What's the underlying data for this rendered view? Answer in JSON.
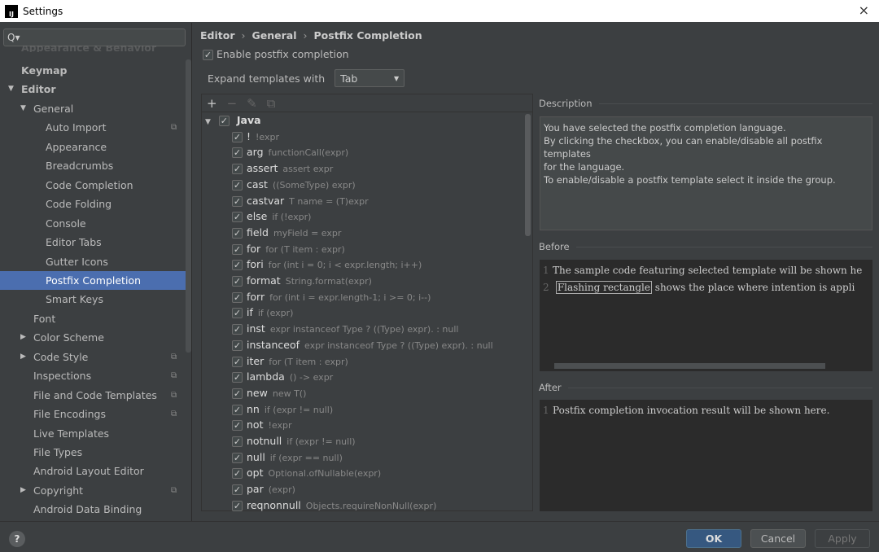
{
  "window": {
    "title": "Settings",
    "app_icon": "intellij-icon",
    "close": "×"
  },
  "sidebar": {
    "search_placeholder": "",
    "search_icon": "Q▾",
    "faded_item": "Appearance & Behavior",
    "items": [
      {
        "label": "Keymap",
        "level": 0,
        "bold": true
      },
      {
        "label": "Editor",
        "level": 0,
        "bold": true,
        "expanded": true
      },
      {
        "label": "General",
        "level": 1,
        "expanded": true
      },
      {
        "label": "Auto Import",
        "level": 2,
        "copy": true
      },
      {
        "label": "Appearance",
        "level": 2
      },
      {
        "label": "Breadcrumbs",
        "level": 2
      },
      {
        "label": "Code Completion",
        "level": 2
      },
      {
        "label": "Code Folding",
        "level": 2
      },
      {
        "label": "Console",
        "level": 2
      },
      {
        "label": "Editor Tabs",
        "level": 2
      },
      {
        "label": "Gutter Icons",
        "level": 2
      },
      {
        "label": "Postfix Completion",
        "level": 2,
        "selected": true
      },
      {
        "label": "Smart Keys",
        "level": 2
      },
      {
        "label": "Font",
        "level": 1
      },
      {
        "label": "Color Scheme",
        "level": 1,
        "collapsed": true
      },
      {
        "label": "Code Style",
        "level": 1,
        "collapsed": true,
        "copy": true
      },
      {
        "label": "Inspections",
        "level": 1,
        "copy": true
      },
      {
        "label": "File and Code Templates",
        "level": 1,
        "copy": true
      },
      {
        "label": "File Encodings",
        "level": 1,
        "copy": true
      },
      {
        "label": "Live Templates",
        "level": 1
      },
      {
        "label": "File Types",
        "level": 1
      },
      {
        "label": "Android Layout Editor",
        "level": 1
      },
      {
        "label": "Copyright",
        "level": 1,
        "collapsed": true,
        "copy": true
      },
      {
        "label": "Android Data Binding",
        "level": 1
      }
    ]
  },
  "breadcrumb": [
    "Editor",
    "General",
    "Postfix Completion"
  ],
  "breadcrumb_sep": "›",
  "enable_postfix": {
    "label": "Enable postfix completion",
    "checked": true
  },
  "expand": {
    "label": "Expand templates with",
    "value": "Tab"
  },
  "toolbar": {
    "add": "+",
    "remove": "−",
    "edit": "✎",
    "copy": "⧉"
  },
  "templates": {
    "group": "Java",
    "items": [
      {
        "key": "!",
        "desc": "!expr"
      },
      {
        "key": "arg",
        "desc": "functionCall(expr)"
      },
      {
        "key": "assert",
        "desc": "assert expr"
      },
      {
        "key": "cast",
        "desc": "((SomeType) expr)"
      },
      {
        "key": "castvar",
        "desc": "T name = (T)expr"
      },
      {
        "key": "else",
        "desc": "if (!expr)"
      },
      {
        "key": "field",
        "desc": "myField = expr"
      },
      {
        "key": "for",
        "desc": "for (T item : expr)"
      },
      {
        "key": "fori",
        "desc": "for (int i = 0; i < expr.length; i++)"
      },
      {
        "key": "format",
        "desc": "String.format(expr)"
      },
      {
        "key": "forr",
        "desc": "for (int i = expr.length-1; i >= 0; i--)"
      },
      {
        "key": "if",
        "desc": "if (expr)"
      },
      {
        "key": "inst",
        "desc": "expr instanceof Type ? ((Type) expr). : null"
      },
      {
        "key": "instanceof",
        "desc": "expr instanceof Type ? ((Type) expr). : null"
      },
      {
        "key": "iter",
        "desc": "for (T item : expr)"
      },
      {
        "key": "lambda",
        "desc": "() -> expr"
      },
      {
        "key": "new",
        "desc": "new T()"
      },
      {
        "key": "nn",
        "desc": "if (expr != null)"
      },
      {
        "key": "not",
        "desc": "!expr"
      },
      {
        "key": "notnull",
        "desc": "if (expr != null)"
      },
      {
        "key": "null",
        "desc": "if (expr == null)"
      },
      {
        "key": "opt",
        "desc": "Optional.ofNullable(expr)"
      },
      {
        "key": "par",
        "desc": "(expr)"
      },
      {
        "key": "reqnonnull",
        "desc": "Objects.requireNonNull(expr)"
      }
    ]
  },
  "description": {
    "label": "Description",
    "lines": [
      "You have selected the postfix completion language.",
      "By clicking the checkbox, you can enable/disable all postfix templates",
      "for the language.",
      "To enable/disable a postfix template select it inside the group."
    ]
  },
  "before": {
    "label": "Before",
    "line1": "The sample code featuring selected template will be shown he",
    "line2_flash": "Flashing rectangle",
    "line2_rest": " shows the place where intention is appli"
  },
  "after": {
    "label": "After",
    "line1": "Postfix completion invocation result will be shown here."
  },
  "buttons": {
    "help": "?",
    "ok": "OK",
    "cancel": "Cancel",
    "apply": "Apply"
  },
  "colors": {
    "accent": "#4b6eaf",
    "ok_button": "#365880",
    "background": "#3c3f41",
    "editor": "#2b2b2b"
  }
}
